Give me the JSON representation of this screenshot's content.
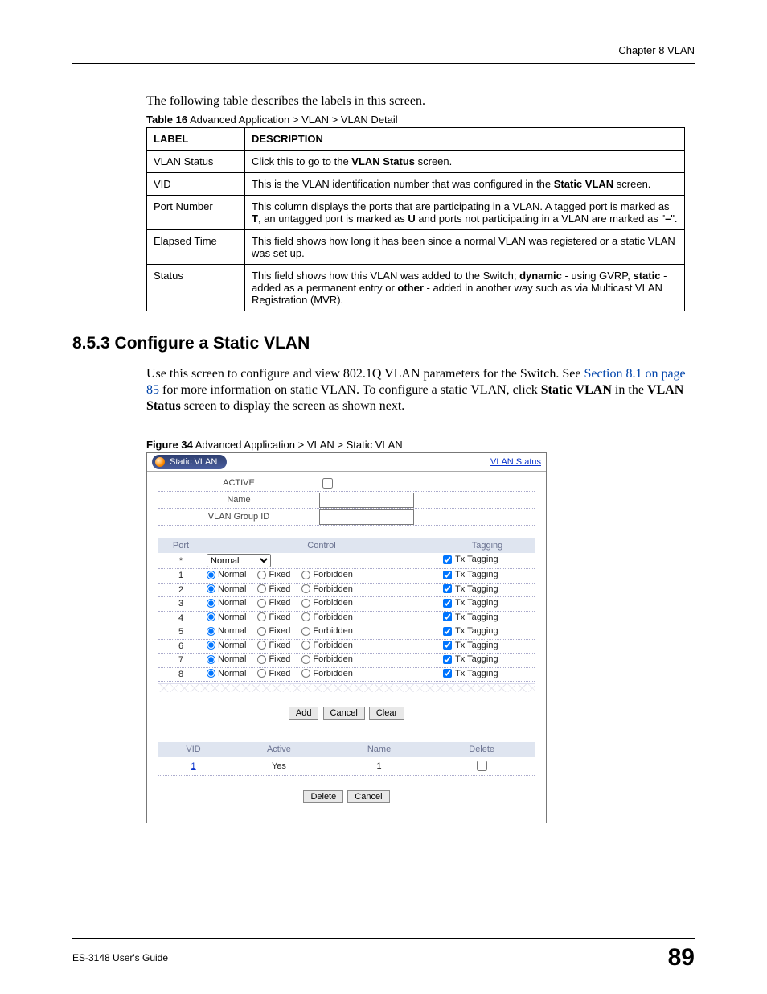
{
  "header": {
    "chapter": "Chapter 8 VLAN"
  },
  "intro": "The following table describes the labels in this screen.",
  "tableCaption": {
    "prefix": "Table 16",
    "rest": "   Advanced Application > VLAN > VLAN Detail"
  },
  "tableHeaders": {
    "label": "LABEL",
    "desc": "DESCRIPTION"
  },
  "tableRows": [
    {
      "label": "VLAN Status",
      "desc_pre": "Click this to go to the ",
      "desc_b": "VLAN Status",
      "desc_post": " screen."
    },
    {
      "label": "VID",
      "desc_pre": "This is the VLAN identification number that was configured in the ",
      "desc_b": "Static VLAN",
      "desc_post": " screen."
    },
    {
      "label": "Port Number",
      "desc_pre": "This column displays the ports that are participating in a VLAN. A tagged port is marked as ",
      "desc_b": "T",
      "desc_mid1": ", an untagged port is marked as ",
      "desc_b2": "U",
      "desc_mid2": " and ports not participating in a VLAN are marked as \"",
      "desc_b3": "–",
      "desc_post": "\"."
    },
    {
      "label": "Elapsed Time",
      "desc_plain": "This field shows how long it has been since a normal VLAN was registered or a static VLAN was set up."
    },
    {
      "label": "Status",
      "desc_pre": "This field shows how this VLAN was added to the Switch; ",
      "desc_b": "dynamic",
      "desc_mid1": " - using GVRP, ",
      "desc_b2": "static",
      "desc_mid2": " - added as a permanent entry or ",
      "desc_b3": "other",
      "desc_post": " - added in another way such as via Multicast VLAN Registration (MVR)."
    }
  ],
  "section": {
    "heading": "8.5.3  Configure a Static VLAN",
    "para_pre": "Use this screen to configure and view 802.1Q VLAN parameters for the Switch. See ",
    "para_link": "Section 8.1 on page 85",
    "para_mid": " for more information on static VLAN. To configure a static VLAN, click ",
    "para_b1": "Static VLAN",
    "para_mid2": " in the ",
    "para_b2": "VLAN Status",
    "para_post": " screen to display the screen as shown next."
  },
  "figureCaption": {
    "prefix": "Figure 34",
    "rest": "   Advanced Application > VLAN > Static VLAN"
  },
  "fig": {
    "tabTitle": "Static VLAN",
    "vlanStatusLink": "VLAN Status",
    "formLabels": {
      "active": "ACTIVE",
      "name": "Name",
      "vlanGroupId": "VLAN Group ID"
    },
    "portHeaders": {
      "port": "Port",
      "control": "Control",
      "tagging": "Tagging"
    },
    "topRow": {
      "port": "*",
      "select": "Normal",
      "tagging": "Tx Tagging"
    },
    "radioLabels": {
      "normal": "Normal",
      "fixed": "Fixed",
      "forbidden": "Forbidden"
    },
    "txTagging": "Tx Tagging",
    "ports": [
      "1",
      "2",
      "3",
      "4",
      "5",
      "6",
      "7",
      "8"
    ],
    "buttons": {
      "add": "Add",
      "cancel": "Cancel",
      "clear": "Clear",
      "delete": "Delete",
      "cancel2": "Cancel"
    },
    "listHeaders": {
      "vid": "VID",
      "active": "Active",
      "name": "Name",
      "delete": "Delete"
    },
    "listRow": {
      "vid": "1",
      "active": "Yes",
      "name": "1"
    }
  },
  "footer": {
    "guide": "ES-3148 User's Guide",
    "page": "89"
  }
}
